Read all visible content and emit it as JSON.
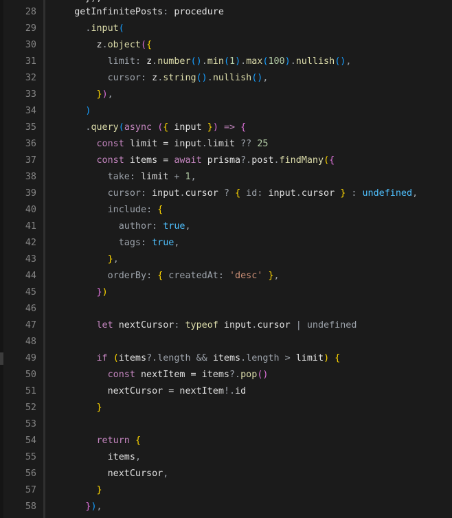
{
  "editor": {
    "clipped_line": "}),",
    "lines": [
      {
        "n": "28",
        "tokens": [
          [
            "    ",
            "v"
          ],
          [
            "getInfinitePosts",
            "v"
          ],
          [
            ": ",
            "p"
          ],
          [
            "procedure",
            "v"
          ]
        ]
      },
      {
        "n": "29",
        "tokens": [
          [
            "      ",
            "v"
          ],
          [
            ".",
            "p"
          ],
          [
            "input",
            "f"
          ],
          [
            "(",
            "c"
          ]
        ]
      },
      {
        "n": "30",
        "tokens": [
          [
            "        ",
            "v"
          ],
          [
            "z",
            "v"
          ],
          [
            ".",
            "p"
          ],
          [
            "object",
            "f"
          ],
          [
            "(",
            "m"
          ],
          [
            "{",
            "y"
          ]
        ]
      },
      {
        "n": "31",
        "tokens": [
          [
            "          ",
            "v"
          ],
          [
            "limit",
            "g"
          ],
          [
            ": ",
            "p"
          ],
          [
            "z",
            "v"
          ],
          [
            ".",
            "p"
          ],
          [
            "number",
            "f"
          ],
          [
            "()",
            "c"
          ],
          [
            ".",
            "p"
          ],
          [
            "min",
            "f"
          ],
          [
            "(",
            "c"
          ],
          [
            "1",
            "n"
          ],
          [
            ")",
            "c"
          ],
          [
            ".",
            "p"
          ],
          [
            "max",
            "f"
          ],
          [
            "(",
            "c"
          ],
          [
            "100",
            "n"
          ],
          [
            ")",
            "c"
          ],
          [
            ".",
            "p"
          ],
          [
            "nullish",
            "f"
          ],
          [
            "()",
            "c"
          ],
          [
            ",",
            "p"
          ]
        ]
      },
      {
        "n": "32",
        "tokens": [
          [
            "          ",
            "v"
          ],
          [
            "cursor",
            "g"
          ],
          [
            ": ",
            "p"
          ],
          [
            "z",
            "v"
          ],
          [
            ".",
            "p"
          ],
          [
            "string",
            "f"
          ],
          [
            "()",
            "c"
          ],
          [
            ".",
            "p"
          ],
          [
            "nullish",
            "f"
          ],
          [
            "()",
            "c"
          ],
          [
            ",",
            "p"
          ]
        ]
      },
      {
        "n": "33",
        "tokens": [
          [
            "        ",
            "v"
          ],
          [
            "}",
            "y"
          ],
          [
            ")",
            "m"
          ],
          [
            ",",
            "p"
          ]
        ]
      },
      {
        "n": "34",
        "tokens": [
          [
            "      ",
            "v"
          ],
          [
            ")",
            "c"
          ]
        ]
      },
      {
        "n": "35",
        "tokens": [
          [
            "      ",
            "v"
          ],
          [
            ".",
            "p"
          ],
          [
            "query",
            "f"
          ],
          [
            "(",
            "c"
          ],
          [
            "async",
            "k"
          ],
          [
            " ",
            "v"
          ],
          [
            "(",
            "m"
          ],
          [
            "{",
            "y"
          ],
          [
            " input ",
            "v"
          ],
          [
            "}",
            "y"
          ],
          [
            ")",
            "m"
          ],
          [
            " ",
            "v"
          ],
          [
            "=>",
            "k"
          ],
          [
            " ",
            "v"
          ],
          [
            "{",
            "m"
          ]
        ]
      },
      {
        "n": "36",
        "tokens": [
          [
            "        ",
            "v"
          ],
          [
            "const",
            "k"
          ],
          [
            " limit = input",
            "v"
          ],
          [
            ".",
            "p"
          ],
          [
            "limit",
            "v"
          ],
          [
            " ?? ",
            "p"
          ],
          [
            "25",
            "n"
          ]
        ]
      },
      {
        "n": "37",
        "tokens": [
          [
            "        ",
            "v"
          ],
          [
            "const",
            "k"
          ],
          [
            " items = ",
            "v"
          ],
          [
            "await",
            "k"
          ],
          [
            " prisma",
            "v"
          ],
          [
            "?.",
            "p"
          ],
          [
            "post",
            "v"
          ],
          [
            ".",
            "p"
          ],
          [
            "findMany",
            "f"
          ],
          [
            "(",
            "y"
          ],
          [
            "{",
            "m"
          ]
        ]
      },
      {
        "n": "38",
        "tokens": [
          [
            "          ",
            "v"
          ],
          [
            "take",
            "g"
          ],
          [
            ": ",
            "p"
          ],
          [
            "limit",
            "v"
          ],
          [
            " + ",
            "p"
          ],
          [
            "1",
            "n"
          ],
          [
            ",",
            "p"
          ]
        ]
      },
      {
        "n": "39",
        "tokens": [
          [
            "          ",
            "v"
          ],
          [
            "cursor",
            "g"
          ],
          [
            ": ",
            "p"
          ],
          [
            "input",
            "v"
          ],
          [
            ".",
            "p"
          ],
          [
            "cursor",
            "v"
          ],
          [
            " ? ",
            "p"
          ],
          [
            "{",
            "y"
          ],
          [
            " id",
            "g"
          ],
          [
            ": ",
            "p"
          ],
          [
            "input",
            "v"
          ],
          [
            ".",
            "p"
          ],
          [
            "cursor",
            "v"
          ],
          [
            " ",
            "v"
          ],
          [
            "}",
            "y"
          ],
          [
            " : ",
            "p"
          ],
          [
            "undefined",
            "t"
          ],
          [
            ",",
            "p"
          ]
        ]
      },
      {
        "n": "40",
        "tokens": [
          [
            "          ",
            "v"
          ],
          [
            "include",
            "g"
          ],
          [
            ": ",
            "p"
          ],
          [
            "{",
            "y"
          ]
        ]
      },
      {
        "n": "41",
        "tokens": [
          [
            "            ",
            "v"
          ],
          [
            "author",
            "g"
          ],
          [
            ": ",
            "p"
          ],
          [
            "true",
            "t"
          ],
          [
            ",",
            "p"
          ]
        ]
      },
      {
        "n": "42",
        "tokens": [
          [
            "            ",
            "v"
          ],
          [
            "tags",
            "g"
          ],
          [
            ": ",
            "p"
          ],
          [
            "true",
            "t"
          ],
          [
            ",",
            "p"
          ]
        ]
      },
      {
        "n": "43",
        "tokens": [
          [
            "          ",
            "v"
          ],
          [
            "}",
            "y"
          ],
          [
            ",",
            "p"
          ]
        ]
      },
      {
        "n": "44",
        "tokens": [
          [
            "          ",
            "v"
          ],
          [
            "orderBy",
            "g"
          ],
          [
            ": ",
            "p"
          ],
          [
            "{",
            "y"
          ],
          [
            " createdAt",
            "g"
          ],
          [
            ": ",
            "p"
          ],
          [
            "'desc'",
            "s"
          ],
          [
            " ",
            "v"
          ],
          [
            "}",
            "y"
          ],
          [
            ",",
            "p"
          ]
        ]
      },
      {
        "n": "45",
        "tokens": [
          [
            "        ",
            "v"
          ],
          [
            "}",
            "m"
          ],
          [
            ")",
            "y"
          ]
        ]
      },
      {
        "n": "46",
        "tokens": []
      },
      {
        "n": "47",
        "tokens": [
          [
            "        ",
            "v"
          ],
          [
            "let",
            "k"
          ],
          [
            " nextCursor",
            "v"
          ],
          [
            ": ",
            "p"
          ],
          [
            "typeof",
            "f"
          ],
          [
            " input",
            "v"
          ],
          [
            ".",
            "p"
          ],
          [
            "cursor",
            "v"
          ],
          [
            " | ",
            "p"
          ],
          [
            "undefined",
            "g"
          ]
        ]
      },
      {
        "n": "48",
        "tokens": []
      },
      {
        "n": "49",
        "tokens": [
          [
            "        ",
            "v"
          ],
          [
            "if",
            "k"
          ],
          [
            " ",
            "v"
          ],
          [
            "(",
            "y"
          ],
          [
            "items",
            "v"
          ],
          [
            "?.",
            "p"
          ],
          [
            "length",
            "g"
          ],
          [
            " && ",
            "p"
          ],
          [
            "items",
            "v"
          ],
          [
            ".",
            "p"
          ],
          [
            "length",
            "g"
          ],
          [
            " > ",
            "p"
          ],
          [
            "limit",
            "v"
          ],
          [
            ")",
            "y"
          ],
          [
            " ",
            "v"
          ],
          [
            "{",
            "y"
          ]
        ]
      },
      {
        "n": "50",
        "tokens": [
          [
            "          ",
            "v"
          ],
          [
            "const",
            "k"
          ],
          [
            " nextItem = items",
            "v"
          ],
          [
            "?.",
            "p"
          ],
          [
            "pop",
            "f"
          ],
          [
            "()",
            "m"
          ]
        ]
      },
      {
        "n": "51",
        "tokens": [
          [
            "          ",
            "v"
          ],
          [
            "nextCursor = nextItem",
            "v"
          ],
          [
            "!",
            "p"
          ],
          [
            ".",
            "p"
          ],
          [
            "id",
            "v"
          ]
        ]
      },
      {
        "n": "52",
        "tokens": [
          [
            "        ",
            "v"
          ],
          [
            "}",
            "y"
          ]
        ]
      },
      {
        "n": "53",
        "tokens": []
      },
      {
        "n": "54",
        "tokens": [
          [
            "        ",
            "v"
          ],
          [
            "return",
            "k"
          ],
          [
            " ",
            "v"
          ],
          [
            "{",
            "y"
          ]
        ]
      },
      {
        "n": "55",
        "tokens": [
          [
            "          ",
            "v"
          ],
          [
            "items",
            "v"
          ],
          [
            ",",
            "p"
          ]
        ]
      },
      {
        "n": "56",
        "tokens": [
          [
            "          ",
            "v"
          ],
          [
            "nextCursor",
            "v"
          ],
          [
            ",",
            "p"
          ]
        ]
      },
      {
        "n": "57",
        "tokens": [
          [
            "        ",
            "v"
          ],
          [
            "}",
            "y"
          ]
        ]
      },
      {
        "n": "58",
        "tokens": [
          [
            "      ",
            "v"
          ],
          [
            "}",
            "m"
          ],
          [
            ")",
            "c"
          ],
          [
            ",",
            "p"
          ]
        ]
      }
    ]
  }
}
